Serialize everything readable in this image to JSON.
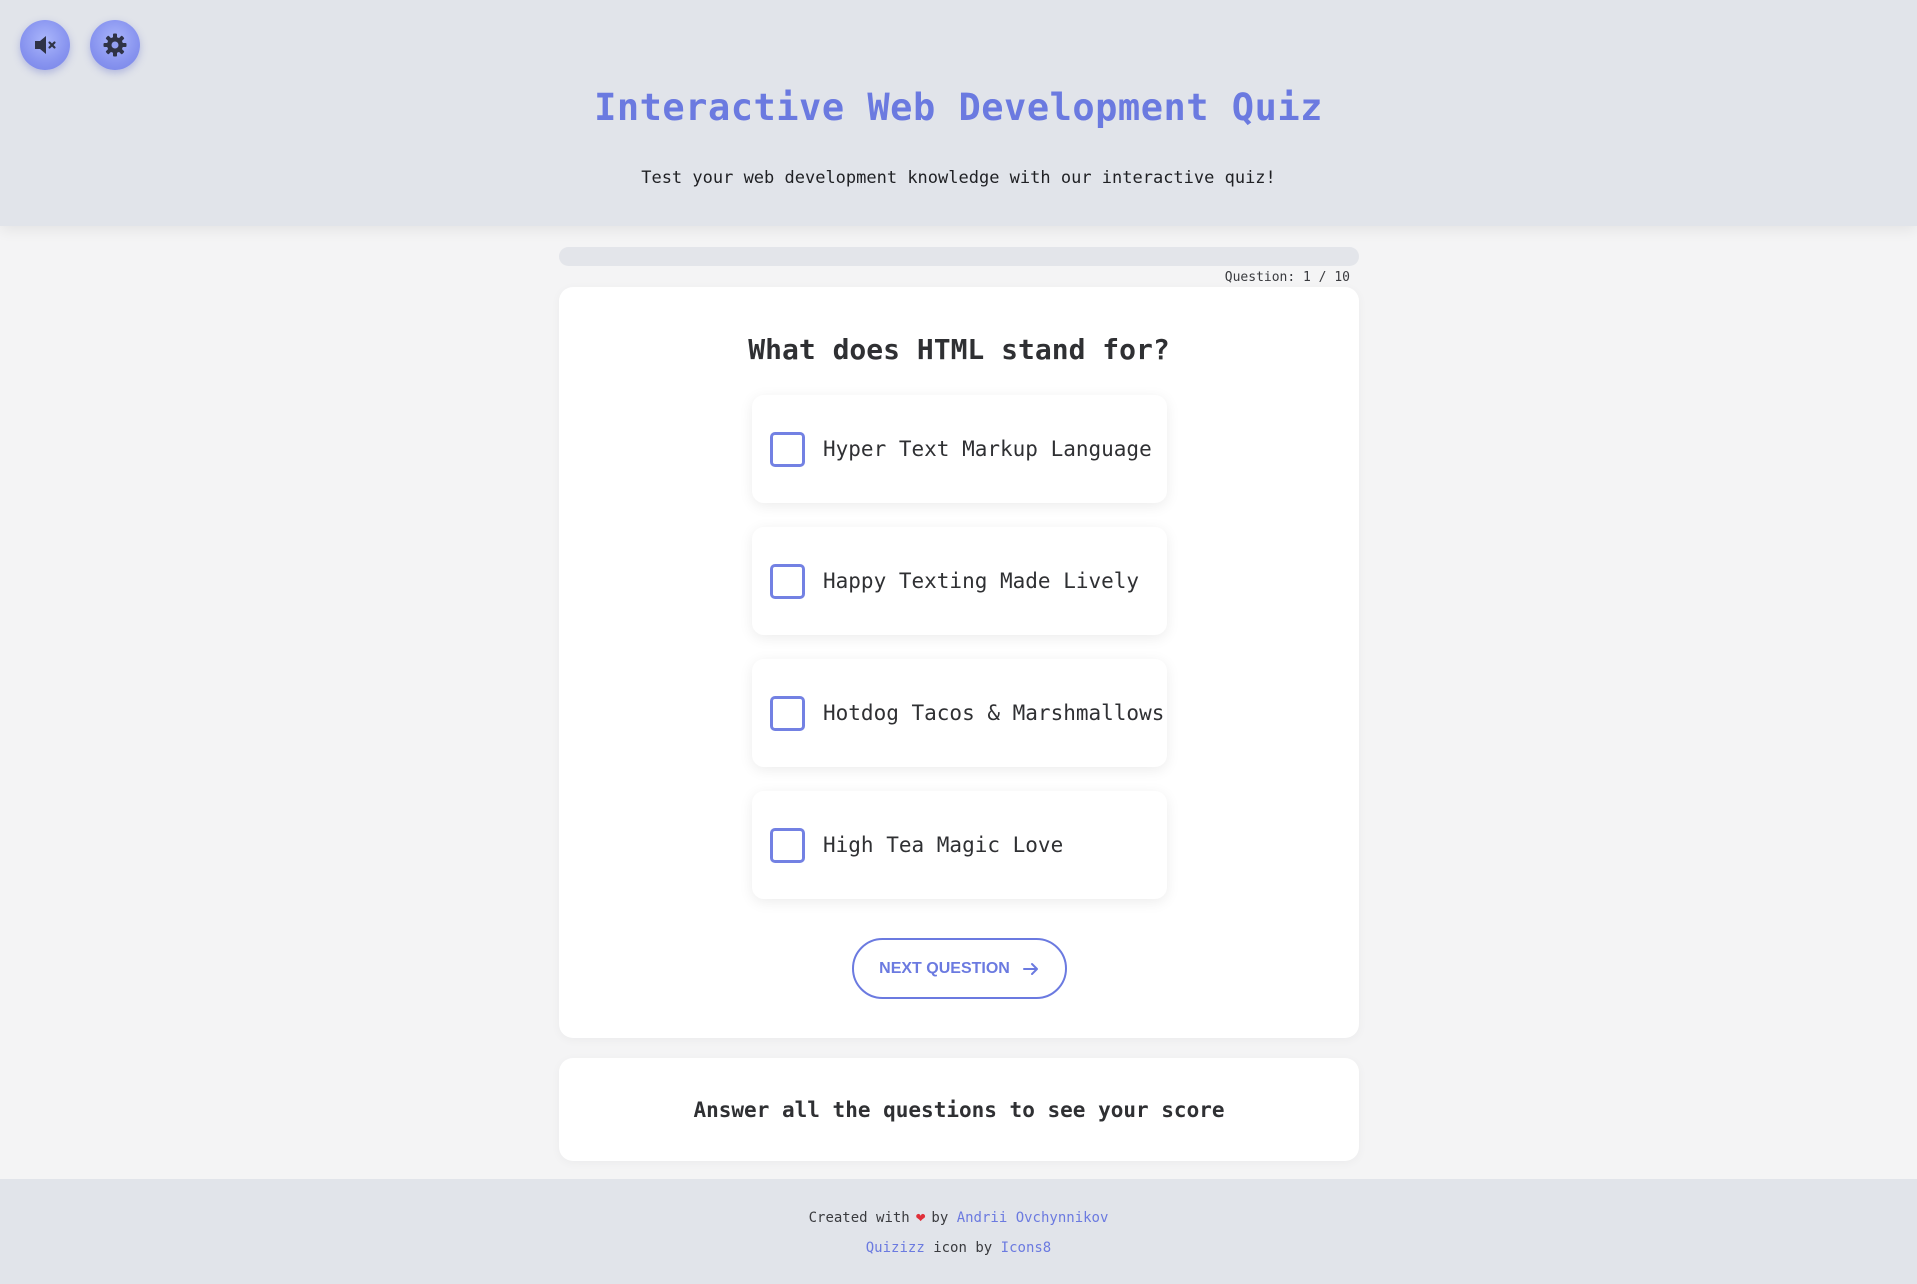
{
  "header": {
    "title": "Interactive Web Development Quiz",
    "subtitle": "Test your web development knowledge with our interactive quiz!",
    "mute_icon": "speaker-muted-icon",
    "settings_icon": "gear-icon"
  },
  "progress": {
    "label": "Question: 1 / 10",
    "current": 1,
    "total": 10,
    "fraction": 0
  },
  "quiz": {
    "question": "What does HTML stand for?",
    "answers": [
      "Hyper Text Markup Language",
      "Happy Texting Made Lively",
      "Hotdog Tacos & Marshmallows",
      "High Tea Magic Love"
    ],
    "next_label": "NEXT QUESTION",
    "next_icon": "arrow-right-icon"
  },
  "score": {
    "message": "Answer all the questions to see your score"
  },
  "footer": {
    "created_with": "Created with",
    "heart": "❤",
    "by": "by",
    "author": "Andrii Ovchynnikov",
    "quizizz": "Quizizz",
    "icon_by": "icon by",
    "icons8": "Icons8"
  },
  "colors": {
    "accent": "#6b7ae0",
    "header_bg": "#e1e4ea",
    "page_bg": "#f4f4f5",
    "heart": "#e0303a"
  }
}
